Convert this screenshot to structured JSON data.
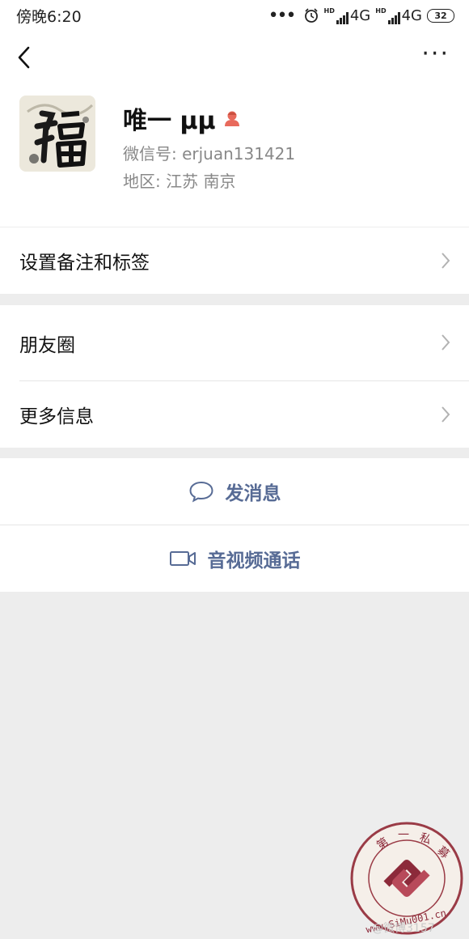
{
  "status_bar": {
    "time": "傍晚6:20",
    "network_1": "4G",
    "network_2": "4G",
    "hd_1": "HD",
    "hd_2": "HD",
    "battery": "32"
  },
  "profile": {
    "nickname": "唯一 μμ",
    "wechat_id": "微信号: erjuan131421",
    "region": "地区: 江苏  南京"
  },
  "menu": {
    "remark_tags": "设置备注和标签",
    "moments": "朋友圈",
    "more_info": "更多信息"
  },
  "actions": {
    "send_message": "发消息",
    "video_call": "音视频通话"
  },
  "watermark": {
    "brand": "第一私募",
    "url": "www.SiMu001.cn",
    "handle": "@微博3157"
  },
  "colors": {
    "link": "#576b95",
    "background": "#ededed",
    "gender_female": "#e86a5c"
  }
}
